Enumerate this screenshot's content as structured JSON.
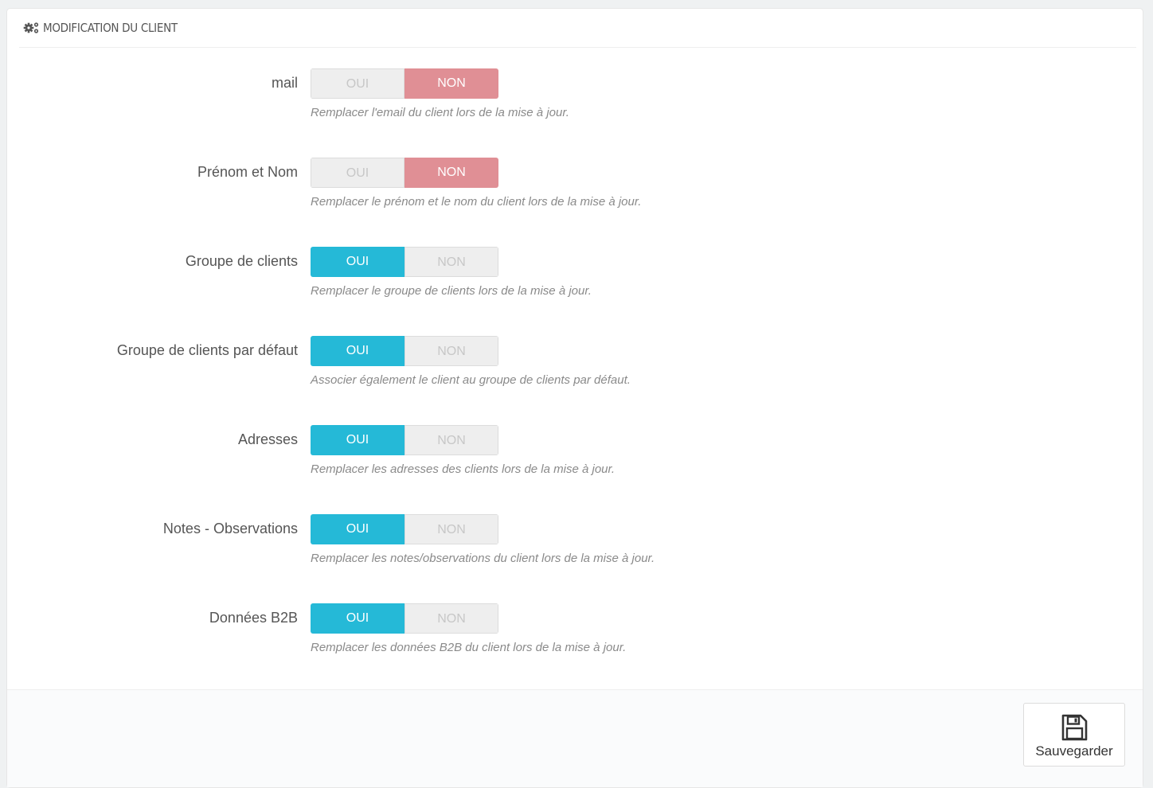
{
  "panel": {
    "heading": "MODIFICATION DU CLIENT",
    "heading_icon": "cogs-icon"
  },
  "colors": {
    "yes_active": "#25b9d7",
    "no_active": "#e08f95",
    "inactive": "#eeeeee"
  },
  "fields": [
    {
      "label": "mail",
      "yes_label": "OUI",
      "no_label": "NON",
      "value": "NON",
      "help": "Remplacer l'email du client lors de la mise à jour."
    },
    {
      "label": "Prénom et Nom",
      "yes_label": "OUI",
      "no_label": "NON",
      "value": "NON",
      "help": "Remplacer le prénom et le nom du client lors de la mise à jour."
    },
    {
      "label": "Groupe de clients",
      "yes_label": "OUI",
      "no_label": "NON",
      "value": "OUI",
      "help": "Remplacer le groupe de clients lors de la mise à jour."
    },
    {
      "label": "Groupe de clients par défaut",
      "yes_label": "OUI",
      "no_label": "NON",
      "value": "OUI",
      "help": "Associer également le client au groupe de clients par défaut."
    },
    {
      "label": "Adresses",
      "yes_label": "OUI",
      "no_label": "NON",
      "value": "OUI",
      "help": "Remplacer les adresses des clients lors de la mise à jour."
    },
    {
      "label": "Notes - Observations",
      "yes_label": "OUI",
      "no_label": "NON",
      "value": "OUI",
      "help": "Remplacer les notes/observations du client lors de la mise à jour."
    },
    {
      "label": "Données B2B",
      "yes_label": "OUI",
      "no_label": "NON",
      "value": "OUI",
      "help": "Remplacer les données B2B du client lors de la mise à jour."
    }
  ],
  "footer": {
    "save_label": "Sauvegarder",
    "save_icon": "floppy-disk-icon"
  }
}
